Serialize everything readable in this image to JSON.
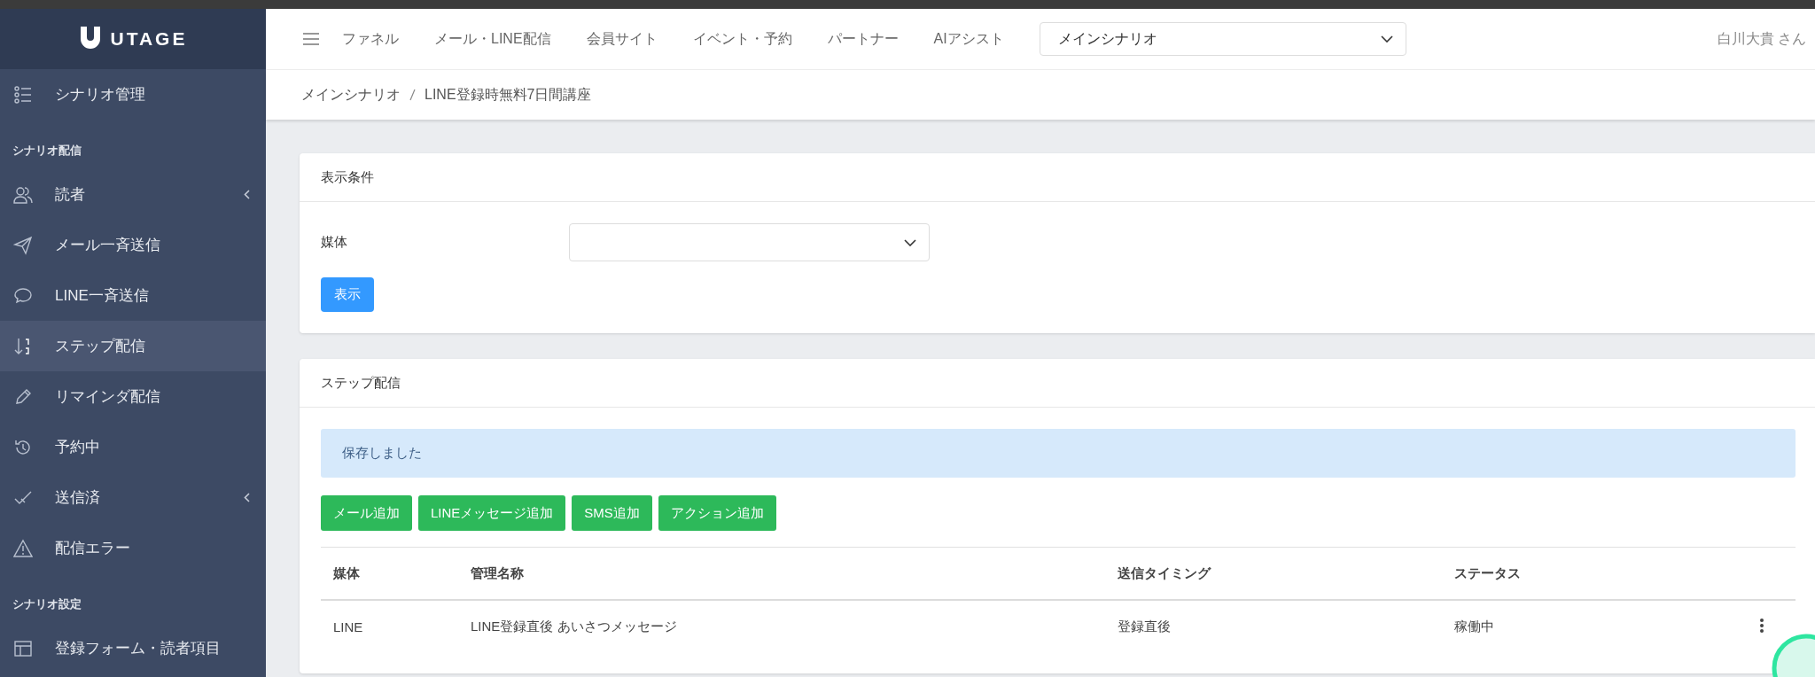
{
  "logo": "UTAGE",
  "sidebar": {
    "items": [
      {
        "kind": "item",
        "label": "シナリオ管理",
        "selected": false,
        "expandable": false
      },
      {
        "kind": "section",
        "label": "シナリオ配信"
      },
      {
        "kind": "item",
        "label": "読者",
        "selected": false,
        "expandable": true
      },
      {
        "kind": "item",
        "label": "メール一斉送信",
        "selected": false,
        "expandable": false
      },
      {
        "kind": "item",
        "label": "LINE一斉送信",
        "selected": false,
        "expandable": false
      },
      {
        "kind": "item",
        "label": "ステップ配信",
        "selected": true,
        "expandable": false
      },
      {
        "kind": "item",
        "label": "リマインダ配信",
        "selected": false,
        "expandable": false
      },
      {
        "kind": "item",
        "label": "予約中",
        "selected": false,
        "expandable": false
      },
      {
        "kind": "item",
        "label": "送信済",
        "selected": false,
        "expandable": true
      },
      {
        "kind": "item",
        "label": "配信エラー",
        "selected": false,
        "expandable": false
      },
      {
        "kind": "section",
        "label": "シナリオ設定"
      },
      {
        "kind": "item",
        "label": "登録フォーム・読者項目",
        "selected": false,
        "expandable": false
      }
    ]
  },
  "top_nav": {
    "items": [
      "ファネル",
      "メール・LINE配信",
      "会員サイト",
      "イベント・予約",
      "パートナー",
      "AIアシスト"
    ],
    "scenario_select": {
      "value": "メインシナリオ"
    },
    "user": "白川大貴 さん"
  },
  "breadcrumb": [
    "メインシナリオ",
    "LINE登録時無料7日間講座"
  ],
  "filter_panel": {
    "title": "表示条件",
    "field_label": "媒体",
    "button": "表示"
  },
  "step_panel": {
    "title": "ステップ配信",
    "alert": "保存しました",
    "buttons": [
      "メール追加",
      "LINEメッセージ追加",
      "SMS追加",
      "アクション追加"
    ],
    "table": {
      "columns": [
        "媒体",
        "管理名称",
        "送信タイミング",
        "ステータス"
      ],
      "rows": [
        {
          "cells": [
            "LINE",
            "LINE登録直後 あいさつメッセージ",
            "登録直後",
            "稼働中"
          ]
        }
      ]
    }
  }
}
